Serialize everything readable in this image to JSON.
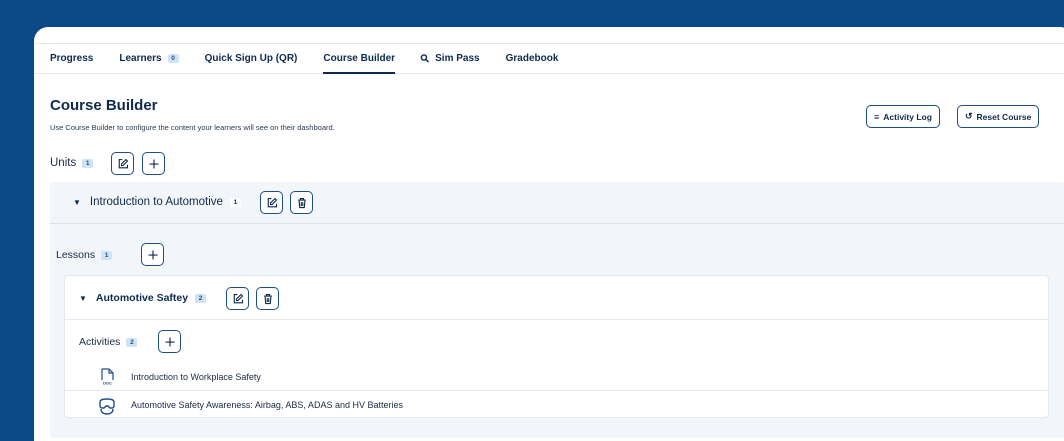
{
  "tabs": [
    {
      "label": "Progress"
    },
    {
      "label": "Learners",
      "badge": "0"
    },
    {
      "label": "Quick Sign Up (QR)"
    },
    {
      "label": "Course Builder",
      "active": true
    },
    {
      "label": "Sim Pass",
      "icon": "key-icon"
    },
    {
      "label": "Gradebook"
    }
  ],
  "header": {
    "title": "Course Builder",
    "subtitle": "Use Course Builder to configure the content your learners will see on their dashboard.",
    "activity_log_label": "Activity Log",
    "reset_course_label": "Reset Course"
  },
  "units": {
    "label": "Units",
    "count": "1",
    "items": [
      {
        "title": "Introduction to Automotive",
        "count": "1",
        "lessons_label": "Lessons",
        "lessons_count": "1",
        "lessons": [
          {
            "title": "Automotive Saftey",
            "count": "2",
            "activities_label": "Activities",
            "activities_count": "2",
            "activities": [
              {
                "title": "Introduction to Workplace Safety",
                "icon": "document-icon"
              },
              {
                "title": "Automotive Safety Awareness: Airbag, ABS, ADAS and HV Batteries",
                "icon": "vr-headset-icon"
              }
            ]
          }
        ]
      }
    ]
  },
  "colors": {
    "background": "#0c4a85",
    "accent": "#1d4e85",
    "badge": "#cfe3f7",
    "panel": "#f2f5f9"
  }
}
